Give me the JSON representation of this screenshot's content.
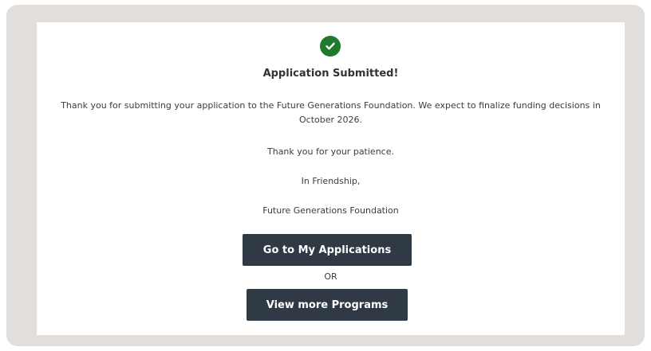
{
  "confirmation": {
    "icon": "check-circle-icon",
    "title": "Application Submitted!",
    "message": "Thank you for submitting your application to the Future Generations Foundation.  We expect to finalize funding decisions in October 2026.",
    "patience": "Thank you for your patience.",
    "closing": "In Friendship,",
    "signature": "Future Generations Foundation"
  },
  "actions": {
    "applications_label": "Go to My Applications",
    "or_label": "OR",
    "programs_label": "View more Programs"
  },
  "colors": {
    "success": "#1f7a2e",
    "button": "#2f3a45",
    "backdrop": "#e1dedb"
  }
}
